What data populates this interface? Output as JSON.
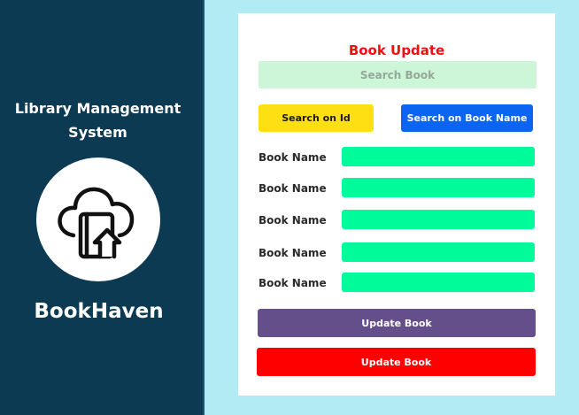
{
  "sidebar": {
    "app_title_line1": "Library Management",
    "app_title_line2": "System",
    "logo_icon": "cloud-book-upload-icon",
    "brand_name": "BookHaven"
  },
  "form": {
    "title": "Book Update",
    "search_placeholder": "Search Book",
    "search_value": "",
    "search_on_id_label": "Search on Id",
    "search_on_name_label": "Search on Book Name",
    "fields": [
      {
        "label": "Book Name",
        "value": ""
      },
      {
        "label": "Book Name",
        "value": ""
      },
      {
        "label": "Book Name",
        "value": ""
      },
      {
        "label": "Book Name",
        "value": ""
      },
      {
        "label": "Book Name",
        "value": ""
      }
    ],
    "update_button_1": "Update Book",
    "update_button_2": "Update Book"
  },
  "colors": {
    "sidebar_bg": "#0b3a52",
    "page_bg": "#b3ebf5",
    "title_red": "#ee1111",
    "search_bg": "#cdf6d9",
    "yellow_button": "#fde013",
    "blue_button": "#0c65f0",
    "field_green": "#00fb9a",
    "purple_button": "#654f8a",
    "red_button": "#fe0000"
  }
}
